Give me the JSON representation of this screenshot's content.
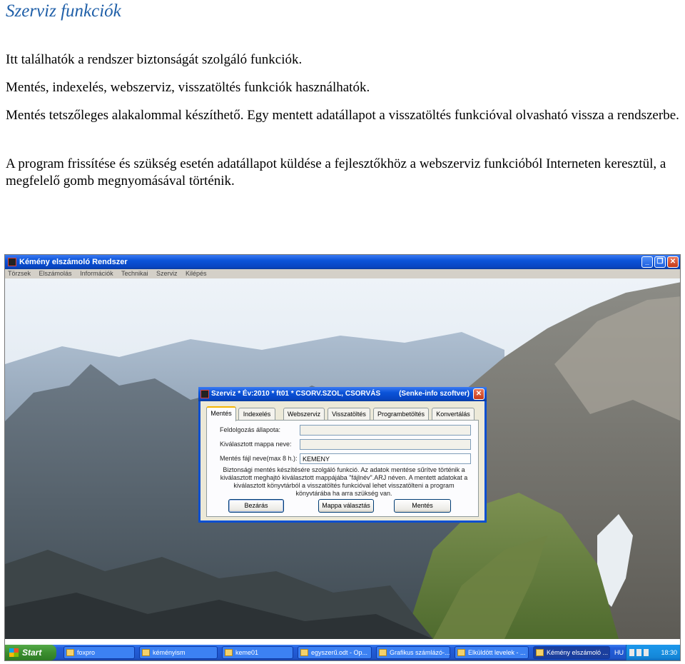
{
  "document": {
    "title": "Szerviz funkciók",
    "paragraphs": [
      "Itt találhatók a rendszer biztonságát szolgáló funkciók.",
      "Mentés, indexelés, webszerviz, visszatöltés funkciók használhatók.",
      "Mentés tetszőleges alakalommal készíthető. Egy mentett adatállapot a visszatöltés funkcióval olvasható vissza a rendszerbe.",
      "A program frissítése és szükség esetén adatállapot küldése a fejlesztőkhöz a webszerviz funkcióból Interneten keresztül, a megfelelő gomb megnyomásával történik."
    ]
  },
  "main_window": {
    "title": "Kémény elszámoló Rendszer",
    "menu": [
      "Törzsek",
      "Elszámolás",
      "Információk",
      "Technikai",
      "Szerviz",
      "Kilépés"
    ]
  },
  "dialog": {
    "title": "Szerviz * Év:2010 * ft01 * CSORV.SZOL, CSORVÁS",
    "vendor": "(Senke-info szoftver)",
    "tabs": [
      "Mentés",
      "Indexelés",
      "Webszerviz",
      "Visszatöltés",
      "Programbetöltés",
      "Konvertálás"
    ],
    "active_tab": "Mentés",
    "fields": [
      {
        "label": "Feldolgozás állapota:",
        "value": ""
      },
      {
        "label": "Kiválasztott mappa neve:",
        "value": ""
      },
      {
        "label": "Mentés fájl neve(max 8 h.):",
        "value": "KEMENY"
      }
    ],
    "info": "Biztonsági mentés készítésére szolgáló funkció. Az adatok mentése sűrítve történik a kiválasztott meghajtó kiválasztott mappájába \"fájlnév\".ARJ néven. A mentett adatokat  a kiválasztott könyvtárból a visszatöltés funkcióval lehet visszatölteni a program könyvtárába ha arra szükség van.",
    "buttons": {
      "close": "Bezárás",
      "folder": "Mappa választás",
      "save": "Mentés"
    }
  },
  "taskbar": {
    "start": "Start",
    "tasks": [
      "foxpro",
      "kéményism",
      "keme01",
      "egyszerű.odt - Op...",
      "Grafikus számlázó-...",
      "Elküldött levelek - ...",
      "Kémény elszámoló ..."
    ],
    "lang": "HU",
    "clock": "18:30"
  },
  "colors": {
    "title_blue": "#1f5fa8",
    "xp_blue": "#0a53d8",
    "start_green": "#3c8f30",
    "tab_highlight": "#f5b500"
  }
}
